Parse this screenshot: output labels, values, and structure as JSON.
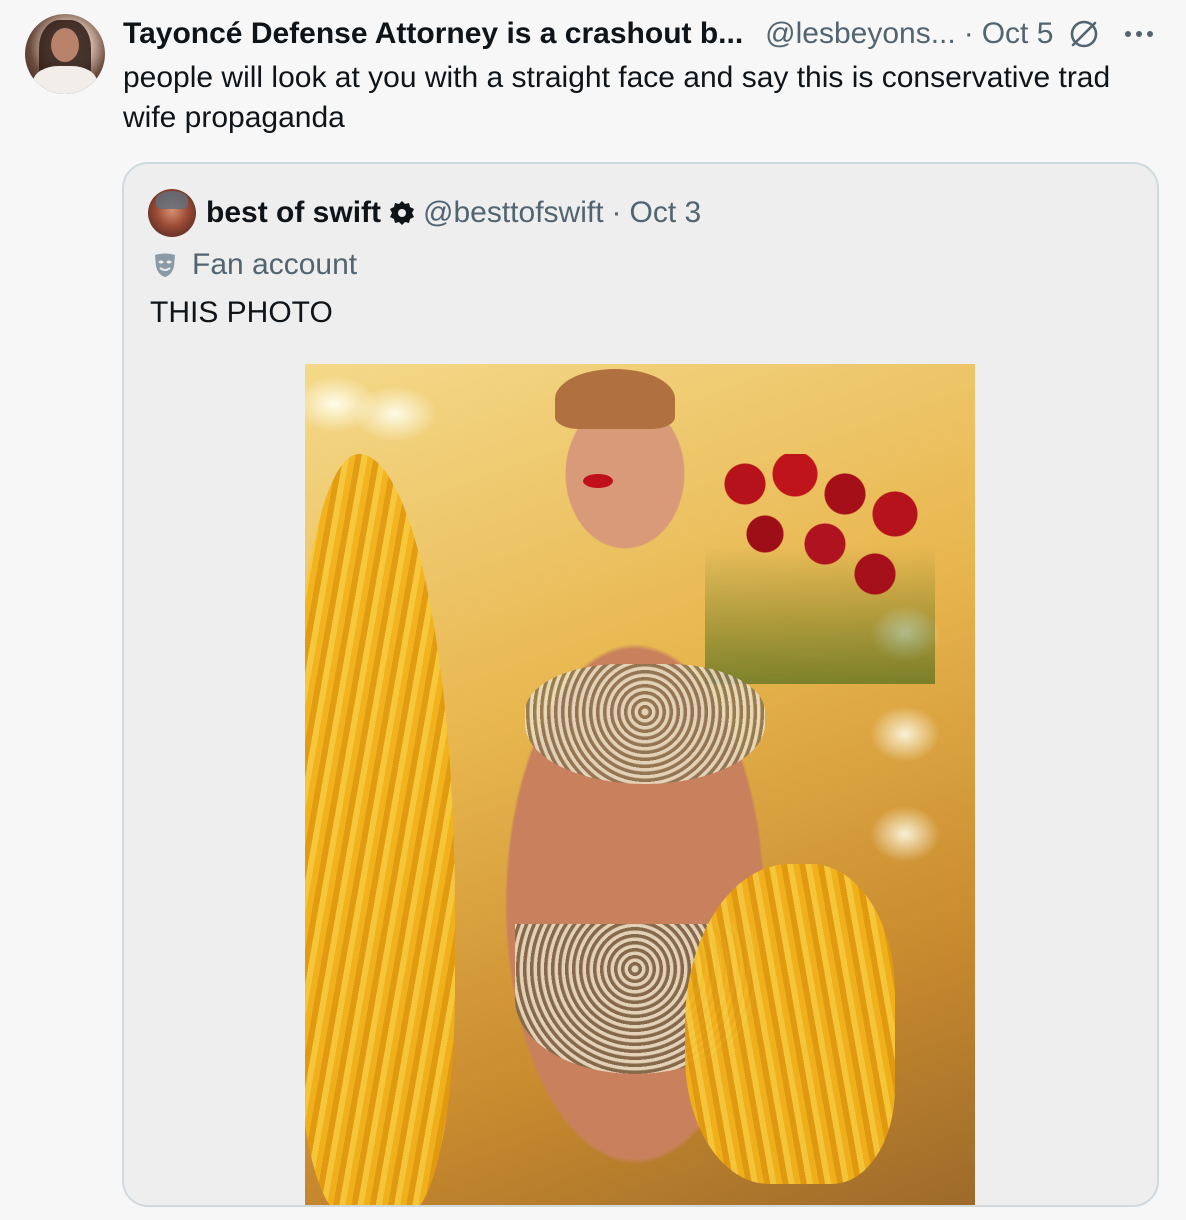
{
  "tweet": {
    "display_name": "Tayoncé Defense Attorney is a crashout b...",
    "handle": "@lesbeyons...",
    "separator": "·",
    "date": "Oct 5",
    "text": "people will look at you with a straight face and say this is conservative trad wife propaganda",
    "icons": {
      "grok": "grok-icon",
      "more": "more-icon"
    }
  },
  "quote": {
    "display_name": "best of swift",
    "handle": "@besttofswift",
    "separator": "·",
    "date": "Oct 3",
    "label": "Fan account",
    "text": "THIS PHOTO",
    "icons": {
      "badge": "verified-badge-icon",
      "label": "theater-mask-icon"
    }
  },
  "colors": {
    "background": "#f7f7f7",
    "quote_background": "#eeeeee",
    "border": "#cfd9de",
    "secondary_text": "#536471",
    "primary_text": "#0f1419"
  }
}
